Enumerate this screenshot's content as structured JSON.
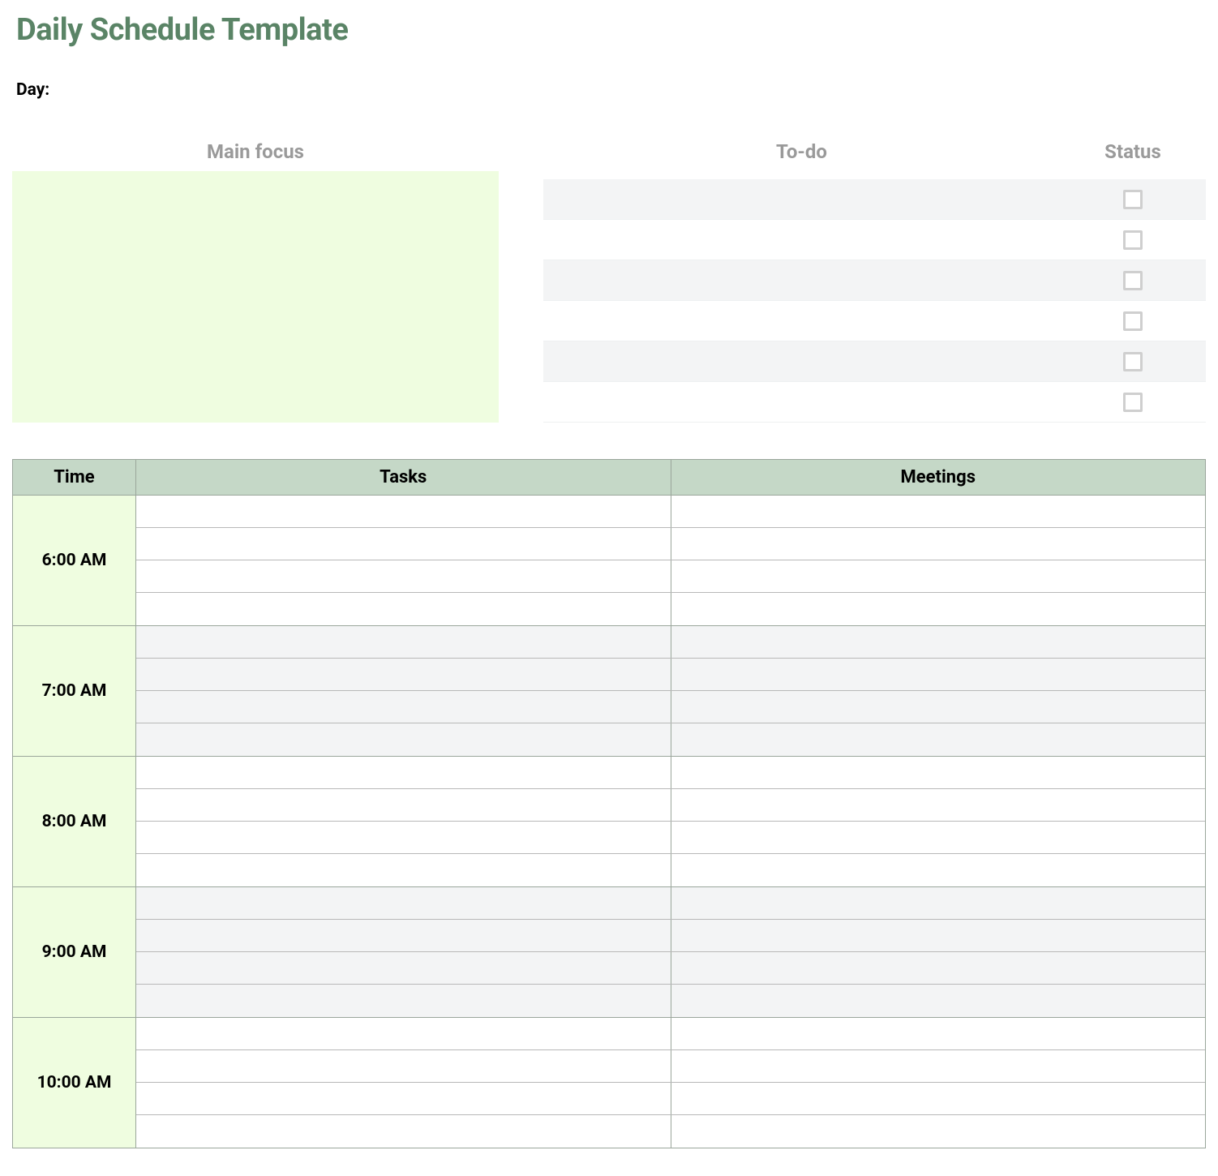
{
  "title": "Daily Schedule Template",
  "day_label": "Day:",
  "headers": {
    "main_focus": "Main focus",
    "todo": "To-do",
    "status": "Status"
  },
  "main_focus_text": "",
  "todo_items": [
    {
      "text": "",
      "done": false
    },
    {
      "text": "",
      "done": false
    },
    {
      "text": "",
      "done": false
    },
    {
      "text": "",
      "done": false
    },
    {
      "text": "",
      "done": false
    },
    {
      "text": "",
      "done": false
    }
  ],
  "schedule_headers": {
    "time": "Time",
    "tasks": "Tasks",
    "meetings": "Meetings"
  },
  "schedule": [
    {
      "time": "6:00 AM",
      "alt": false,
      "rows": [
        {
          "task": "",
          "meeting": ""
        },
        {
          "task": "",
          "meeting": ""
        },
        {
          "task": "",
          "meeting": ""
        },
        {
          "task": "",
          "meeting": ""
        }
      ]
    },
    {
      "time": "7:00 AM",
      "alt": true,
      "rows": [
        {
          "task": "",
          "meeting": ""
        },
        {
          "task": "",
          "meeting": ""
        },
        {
          "task": "",
          "meeting": ""
        },
        {
          "task": "",
          "meeting": ""
        }
      ]
    },
    {
      "time": "8:00 AM",
      "alt": false,
      "rows": [
        {
          "task": "",
          "meeting": ""
        },
        {
          "task": "",
          "meeting": ""
        },
        {
          "task": "",
          "meeting": ""
        },
        {
          "task": "",
          "meeting": ""
        }
      ]
    },
    {
      "time": "9:00 AM",
      "alt": true,
      "rows": [
        {
          "task": "",
          "meeting": ""
        },
        {
          "task": "",
          "meeting": ""
        },
        {
          "task": "",
          "meeting": ""
        },
        {
          "task": "",
          "meeting": ""
        }
      ]
    },
    {
      "time": "10:00 AM",
      "alt": false,
      "rows": [
        {
          "task": "",
          "meeting": ""
        },
        {
          "task": "",
          "meeting": ""
        },
        {
          "task": "",
          "meeting": ""
        },
        {
          "task": "",
          "meeting": ""
        }
      ]
    }
  ]
}
